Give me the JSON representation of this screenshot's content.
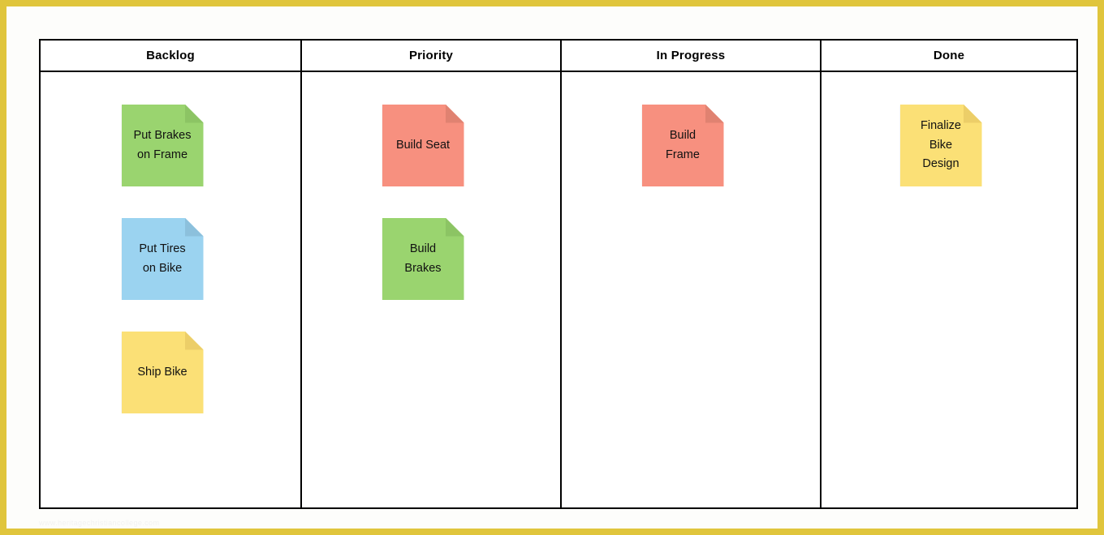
{
  "board": {
    "columns": [
      {
        "id": "backlog",
        "title": "Backlog",
        "notes": [
          {
            "text": "Put Brakes\non Frame",
            "color": "green"
          },
          {
            "text": "Put Tires\non Bike",
            "color": "blue"
          },
          {
            "text": "Ship Bike",
            "color": "yellow"
          }
        ]
      },
      {
        "id": "priority",
        "title": "Priority",
        "notes": [
          {
            "text": "Build Seat",
            "color": "salmon"
          },
          {
            "text": "Build\nBrakes",
            "color": "green"
          }
        ]
      },
      {
        "id": "in-progress",
        "title": "In Progress",
        "notes": [
          {
            "text": "Build\nFrame",
            "color": "salmon"
          }
        ]
      },
      {
        "id": "done",
        "title": "Done",
        "notes": [
          {
            "text": "Finalize\nBike\nDesign",
            "color": "yellow"
          }
        ]
      }
    ]
  },
  "watermark": {
    "text": "www.heritagechristiancollege.com"
  },
  "colors": {
    "page_border": "#e0c53c",
    "grid_line": "#000000",
    "note_green": "#9ad46f",
    "note_blue": "#9bd3f0",
    "note_yellow": "#fbe076",
    "note_salmon": "#f7907f"
  }
}
